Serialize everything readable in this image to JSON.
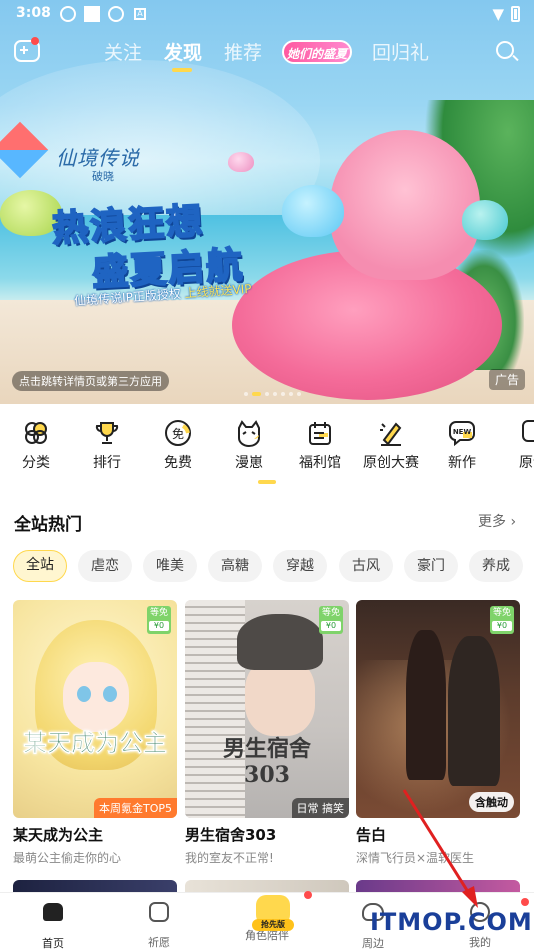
{
  "status_bar": {
    "time": "3:08",
    "notif_letter": "A"
  },
  "top_nav": {
    "tabs": [
      {
        "label": "关注",
        "active": false
      },
      {
        "label": "发现",
        "active": true
      },
      {
        "label": "推荐",
        "active": false
      },
      {
        "label": "她们的盛夏",
        "active": false,
        "special": true
      },
      {
        "label": "回归礼",
        "active": false
      }
    ],
    "accent": "#ffd84d"
  },
  "banner": {
    "game_logo": "仙境传说",
    "game_logo_sub": "破晓",
    "slogan_line1": "热浪狂想",
    "slogan_line2": "盛夏启航",
    "tagline_prefix": "仙境传说IP正版授权",
    "tagline_highlight": "上线就送VIP",
    "redirect_note": "点击跳转详情页或第三方应用",
    "ad_label": "广告",
    "dots_total": 7,
    "dots_active": 1
  },
  "categories": [
    {
      "label": "分类",
      "icon": "clover-icon"
    },
    {
      "label": "排行",
      "icon": "trophy-icon"
    },
    {
      "label": "免费",
      "icon": "free-badge-icon",
      "glyph": "免"
    },
    {
      "label": "漫崽",
      "icon": "mascot-icon"
    },
    {
      "label": "福利馆",
      "icon": "calendar-gift-icon"
    },
    {
      "label": "原创大赛",
      "icon": "pen-icon"
    },
    {
      "label": "新作",
      "icon": "new-badge-icon",
      "glyph": "NEW"
    },
    {
      "label": "原创",
      "icon": "original-icon"
    }
  ],
  "hot": {
    "title": "全站热门",
    "more": "更多 ›",
    "chips": [
      {
        "label": "全站",
        "active": true
      },
      {
        "label": "虐恋",
        "active": false
      },
      {
        "label": "唯美",
        "active": false
      },
      {
        "label": "高糖",
        "active": false
      },
      {
        "label": "穿越",
        "active": false
      },
      {
        "label": "古风",
        "active": false
      },
      {
        "label": "豪门",
        "active": false
      },
      {
        "label": "养成",
        "active": false
      }
    ],
    "cards": [
      {
        "title": "某天成为公主",
        "subtitle": "最萌公主偷走你的心",
        "cover_text": "某天成为公主",
        "free_top": "等免",
        "free_bottom": "¥0",
        "tag": "本周氪金TOP5",
        "tag_color": "#ff7a2e"
      },
      {
        "title": "男生宿舍303",
        "subtitle": "我的室友不正常!",
        "cover_text_1": "男生宿舍",
        "cover_text_2": "303",
        "free_top": "等免",
        "free_bottom": "¥0",
        "tag": "日常 搞笑",
        "tag_color": "rgba(0,0,0,0.55)"
      },
      {
        "title": "告白",
        "subtitle": "深情飞行员×温软医生",
        "free_top": "等免",
        "free_bottom": "¥0",
        "touch_label": "含触动"
      }
    ]
  },
  "bottom_nav": {
    "items": [
      {
        "label": "首页",
        "active": true
      },
      {
        "label": "祈愿",
        "active": false
      },
      {
        "label": "角色陪伴",
        "active": false,
        "badge": "抢先版"
      },
      {
        "label": "周边",
        "active": false
      },
      {
        "label": "我的",
        "active": false
      }
    ]
  },
  "watermark": "ITMOP.COM",
  "colors": {
    "accent_yellow": "#ffd84d",
    "red_dot": "#ff4b4b",
    "free_green": "#7fd36a",
    "arrow_red": "#e02020"
  }
}
